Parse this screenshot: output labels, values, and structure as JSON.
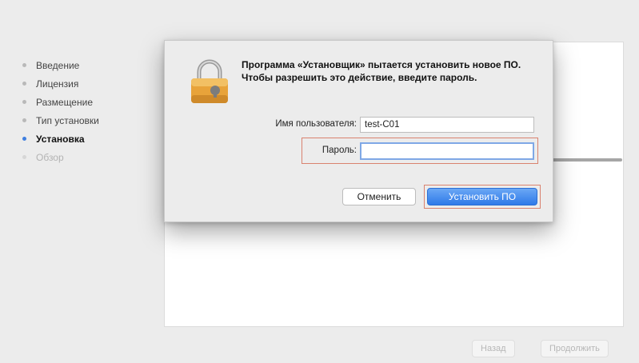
{
  "installer": {
    "steps": [
      {
        "label": "Введение",
        "state": "done"
      },
      {
        "label": "Лицензия",
        "state": "done"
      },
      {
        "label": "Размещение",
        "state": "done"
      },
      {
        "label": "Тип установки",
        "state": "done"
      },
      {
        "label": "Установка",
        "state": "active"
      },
      {
        "label": "Обзор",
        "state": "future"
      }
    ],
    "buttons": {
      "back": "Назад",
      "continue": "Продолжить"
    }
  },
  "dialog": {
    "message": "Программа «Установщик» пытается установить новое ПО. Чтобы разрешить это действие, введите пароль.",
    "username_label": "Имя пользователя:",
    "username_value": "test-C01",
    "password_label": "Пароль:",
    "password_value": "",
    "cancel_label": "Отменить",
    "install_label": "Установить ПО",
    "icon": "lock-icon"
  },
  "colors": {
    "accent": "#2f7ae8",
    "highlight": "#d9826f",
    "active_step_dot": "#3f7fe0"
  }
}
